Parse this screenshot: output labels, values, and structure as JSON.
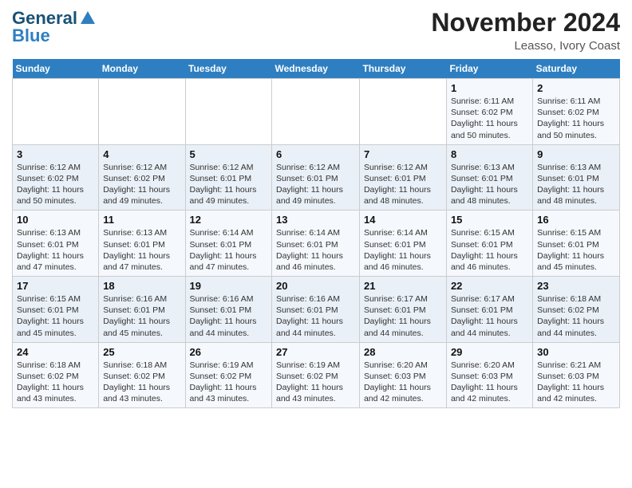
{
  "header": {
    "logo_line1": "General",
    "logo_line2": "Blue",
    "month": "November 2024",
    "location": "Leasso, Ivory Coast"
  },
  "days_of_week": [
    "Sunday",
    "Monday",
    "Tuesday",
    "Wednesday",
    "Thursday",
    "Friday",
    "Saturday"
  ],
  "weeks": [
    [
      {
        "day": "",
        "info": ""
      },
      {
        "day": "",
        "info": ""
      },
      {
        "day": "",
        "info": ""
      },
      {
        "day": "",
        "info": ""
      },
      {
        "day": "",
        "info": ""
      },
      {
        "day": "1",
        "info": "Sunrise: 6:11 AM\nSunset: 6:02 PM\nDaylight: 11 hours and 50 minutes."
      },
      {
        "day": "2",
        "info": "Sunrise: 6:11 AM\nSunset: 6:02 PM\nDaylight: 11 hours and 50 minutes."
      }
    ],
    [
      {
        "day": "3",
        "info": "Sunrise: 6:12 AM\nSunset: 6:02 PM\nDaylight: 11 hours and 50 minutes."
      },
      {
        "day": "4",
        "info": "Sunrise: 6:12 AM\nSunset: 6:02 PM\nDaylight: 11 hours and 49 minutes."
      },
      {
        "day": "5",
        "info": "Sunrise: 6:12 AM\nSunset: 6:01 PM\nDaylight: 11 hours and 49 minutes."
      },
      {
        "day": "6",
        "info": "Sunrise: 6:12 AM\nSunset: 6:01 PM\nDaylight: 11 hours and 49 minutes."
      },
      {
        "day": "7",
        "info": "Sunrise: 6:12 AM\nSunset: 6:01 PM\nDaylight: 11 hours and 48 minutes."
      },
      {
        "day": "8",
        "info": "Sunrise: 6:13 AM\nSunset: 6:01 PM\nDaylight: 11 hours and 48 minutes."
      },
      {
        "day": "9",
        "info": "Sunrise: 6:13 AM\nSunset: 6:01 PM\nDaylight: 11 hours and 48 minutes."
      }
    ],
    [
      {
        "day": "10",
        "info": "Sunrise: 6:13 AM\nSunset: 6:01 PM\nDaylight: 11 hours and 47 minutes."
      },
      {
        "day": "11",
        "info": "Sunrise: 6:13 AM\nSunset: 6:01 PM\nDaylight: 11 hours and 47 minutes."
      },
      {
        "day": "12",
        "info": "Sunrise: 6:14 AM\nSunset: 6:01 PM\nDaylight: 11 hours and 47 minutes."
      },
      {
        "day": "13",
        "info": "Sunrise: 6:14 AM\nSunset: 6:01 PM\nDaylight: 11 hours and 46 minutes."
      },
      {
        "day": "14",
        "info": "Sunrise: 6:14 AM\nSunset: 6:01 PM\nDaylight: 11 hours and 46 minutes."
      },
      {
        "day": "15",
        "info": "Sunrise: 6:15 AM\nSunset: 6:01 PM\nDaylight: 11 hours and 46 minutes."
      },
      {
        "day": "16",
        "info": "Sunrise: 6:15 AM\nSunset: 6:01 PM\nDaylight: 11 hours and 45 minutes."
      }
    ],
    [
      {
        "day": "17",
        "info": "Sunrise: 6:15 AM\nSunset: 6:01 PM\nDaylight: 11 hours and 45 minutes."
      },
      {
        "day": "18",
        "info": "Sunrise: 6:16 AM\nSunset: 6:01 PM\nDaylight: 11 hours and 45 minutes."
      },
      {
        "day": "19",
        "info": "Sunrise: 6:16 AM\nSunset: 6:01 PM\nDaylight: 11 hours and 44 minutes."
      },
      {
        "day": "20",
        "info": "Sunrise: 6:16 AM\nSunset: 6:01 PM\nDaylight: 11 hours and 44 minutes."
      },
      {
        "day": "21",
        "info": "Sunrise: 6:17 AM\nSunset: 6:01 PM\nDaylight: 11 hours and 44 minutes."
      },
      {
        "day": "22",
        "info": "Sunrise: 6:17 AM\nSunset: 6:01 PM\nDaylight: 11 hours and 44 minutes."
      },
      {
        "day": "23",
        "info": "Sunrise: 6:18 AM\nSunset: 6:02 PM\nDaylight: 11 hours and 44 minutes."
      }
    ],
    [
      {
        "day": "24",
        "info": "Sunrise: 6:18 AM\nSunset: 6:02 PM\nDaylight: 11 hours and 43 minutes."
      },
      {
        "day": "25",
        "info": "Sunrise: 6:18 AM\nSunset: 6:02 PM\nDaylight: 11 hours and 43 minutes."
      },
      {
        "day": "26",
        "info": "Sunrise: 6:19 AM\nSunset: 6:02 PM\nDaylight: 11 hours and 43 minutes."
      },
      {
        "day": "27",
        "info": "Sunrise: 6:19 AM\nSunset: 6:02 PM\nDaylight: 11 hours and 43 minutes."
      },
      {
        "day": "28",
        "info": "Sunrise: 6:20 AM\nSunset: 6:03 PM\nDaylight: 11 hours and 42 minutes."
      },
      {
        "day": "29",
        "info": "Sunrise: 6:20 AM\nSunset: 6:03 PM\nDaylight: 11 hours and 42 minutes."
      },
      {
        "day": "30",
        "info": "Sunrise: 6:21 AM\nSunset: 6:03 PM\nDaylight: 11 hours and 42 minutes."
      }
    ]
  ]
}
